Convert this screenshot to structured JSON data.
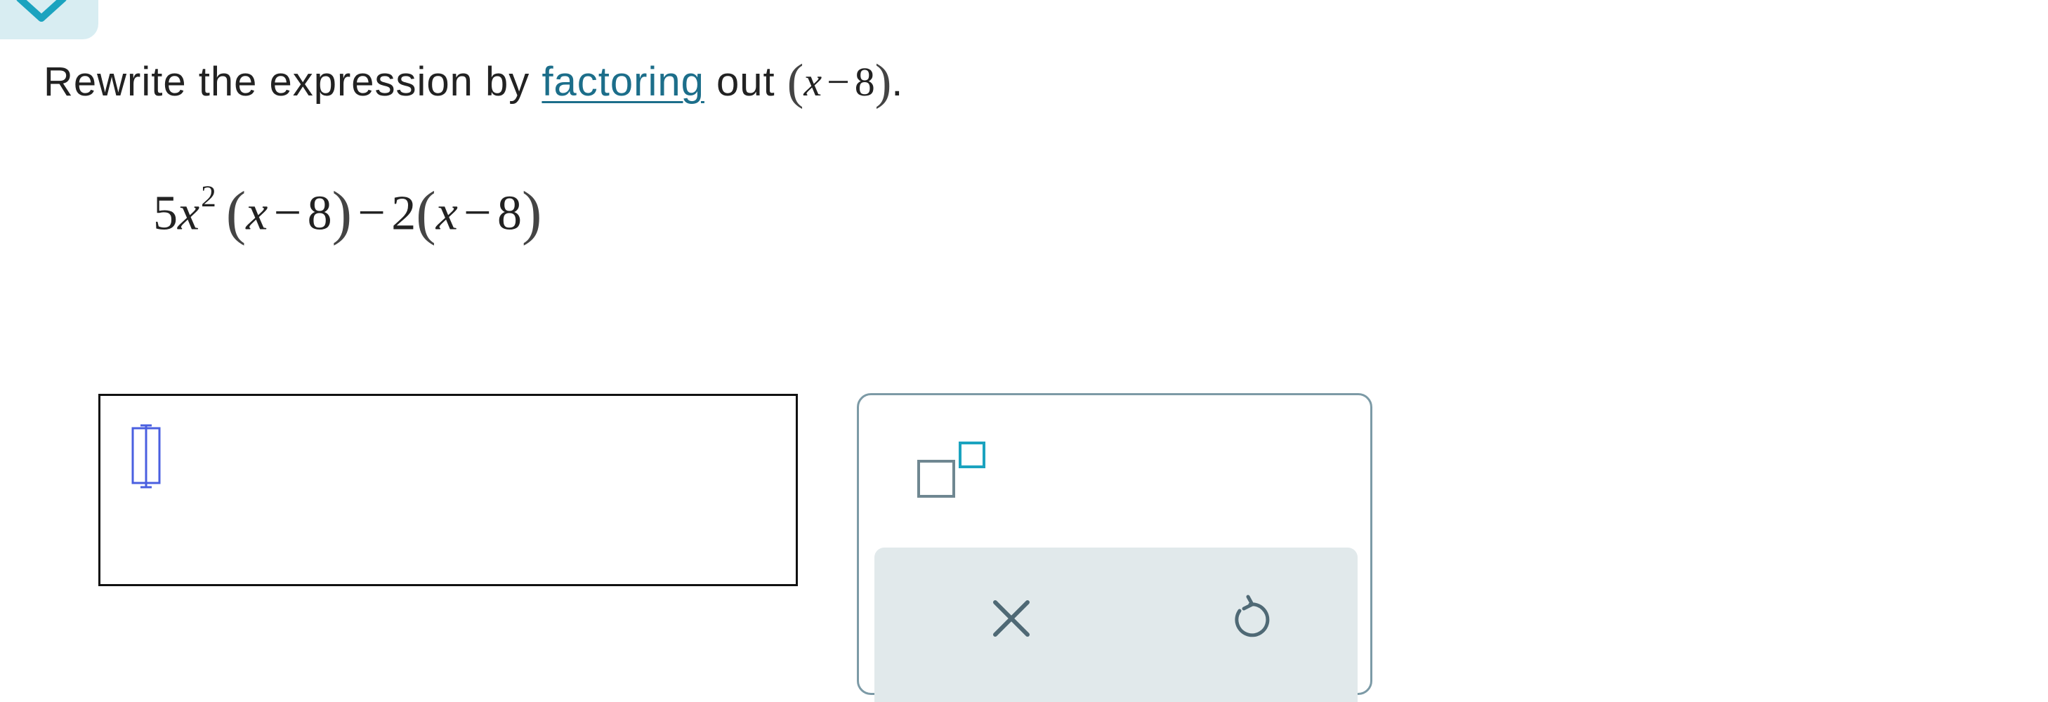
{
  "header": {
    "tab_icon": "chevron-down-icon"
  },
  "question": {
    "prompt_before": "Rewrite the expression by",
    "link_text": "factoring",
    "prompt_after": "out",
    "factor": {
      "variable": "x",
      "operator": "−",
      "constant": "8"
    },
    "end_punctuation": "."
  },
  "expression": {
    "coefficient1": "5",
    "variable1": "x",
    "exponent": "2",
    "factor1_variable": "x",
    "factor1_operator": "−",
    "factor1_constant": "8",
    "middle_operator": "−",
    "coefficient2": "2",
    "factor2_variable": "x",
    "factor2_operator": "−",
    "factor2_constant": "8"
  },
  "answer": {
    "value": "",
    "cursor_icon": "empty-slot-cursor-icon"
  },
  "palette": {
    "exponent_button_icon": "superscript-template-icon",
    "clear_button_icon": "close-icon",
    "undo_button_icon": "undo-icon"
  },
  "colors": {
    "link": "#1c6e8a",
    "accent": "#1ba3bf",
    "palette_border": "#7c9aa6",
    "action_bar_bg": "#e1e9eb",
    "tab_bg": "#d8edf2",
    "cursor": "#4a5fe0"
  }
}
